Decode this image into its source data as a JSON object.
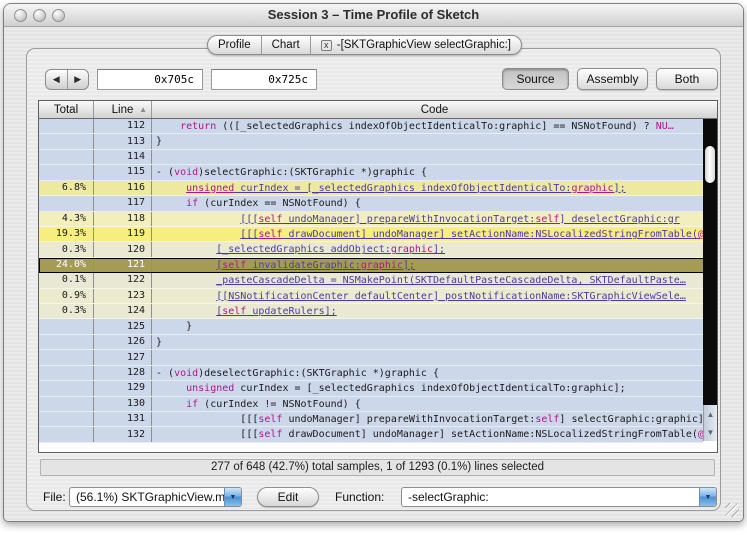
{
  "window": {
    "title": "Session 3 – Time Profile of Sketch",
    "controls": [
      "close",
      "minimize",
      "zoom"
    ]
  },
  "tabs": {
    "items": [
      {
        "label": "Profile",
        "closable": false
      },
      {
        "label": "Chart",
        "closable": false
      },
      {
        "label": "-[SKTGraphicView selectGraphic:]",
        "closable": true,
        "close_glyph": "x"
      }
    ]
  },
  "toolbar": {
    "back_icon": "◀",
    "forward_icon": "▶",
    "addr_start": "0x705c",
    "addr_end": "0x725c",
    "views": [
      {
        "label": "Source",
        "selected": true
      },
      {
        "label": "Assembly",
        "selected": false
      },
      {
        "label": "Both",
        "selected": false
      }
    ]
  },
  "table": {
    "columns": [
      "Total",
      "Line",
      "Code"
    ],
    "sort_column": "Line",
    "sort_ascending": true,
    "rows": [
      {
        "total": "",
        "line": "112",
        "indent": 4,
        "code": [
          [
            "kw",
            "return"
          ],
          [
            "plain",
            " (([_selectedGraphics indexOfObjectIdenticalTo:graphic] == NSNotFound) ? "
          ],
          [
            "kw",
            "NU…"
          ]
        ]
      },
      {
        "total": "",
        "line": "113",
        "indent": 0,
        "code": [
          [
            "plain",
            "}"
          ]
        ]
      },
      {
        "total": "",
        "line": "114",
        "indent": 0,
        "code": []
      },
      {
        "total": "",
        "line": "115",
        "indent": 0,
        "code": [
          [
            "plain",
            "- ("
          ],
          [
            "kw",
            "void"
          ],
          [
            "plain",
            ")selectGraphic:(SKTGraphic *)graphic {"
          ]
        ]
      },
      {
        "total": "6.8%",
        "line": "116",
        "indent": 5,
        "heat": "#eee9a1",
        "code": [
          [
            "kwlink",
            "unsigned"
          ],
          [
            "link",
            " curIndex = [_selectedGraphics indexOfObjectIdenticalTo:"
          ],
          [
            "kwlink",
            "graphic"
          ],
          [
            "link",
            "];"
          ]
        ]
      },
      {
        "total": "",
        "line": "117",
        "indent": 5,
        "code": [
          [
            "kw",
            "if"
          ],
          [
            "plain",
            " (curIndex == NSNotFound) {"
          ]
        ]
      },
      {
        "total": "4.3%",
        "line": "118",
        "indent": 14,
        "heat": "#f3efbd",
        "code": [
          [
            "link",
            "[[["
          ],
          [
            "kwlink",
            "self"
          ],
          [
            "link",
            " undoManager] prepareWithInvocationTarget:"
          ],
          [
            "kwlink",
            "self"
          ],
          [
            "link",
            "] deselectGraphic:gr"
          ]
        ]
      },
      {
        "total": "19.3%",
        "line": "119",
        "indent": 14,
        "heat": "#f6ee7e",
        "code": [
          [
            "link",
            "[[["
          ],
          [
            "kwlink",
            "self"
          ],
          [
            "link",
            " drawDocument] undoManager] setActionName:NSLocalizedStringFromTable("
          ],
          [
            "kwlink",
            "@…"
          ]
        ]
      },
      {
        "total": "0.3%",
        "line": "120",
        "indent": 10,
        "heat": "#eae9d2",
        "code": [
          [
            "link",
            "[_selectedGraphics addObject:"
          ],
          [
            "kwlink",
            "graphic"
          ],
          [
            "link",
            "];"
          ]
        ]
      },
      {
        "total": "24.0%",
        "line": "121",
        "indent": 10,
        "selected": true,
        "heat": "#a49c53",
        "code": [
          [
            "link",
            "["
          ],
          [
            "kwlink",
            "self"
          ],
          [
            "link",
            " invalidateGraphic:"
          ],
          [
            "kwlink",
            "graphic"
          ],
          [
            "link",
            "];"
          ]
        ]
      },
      {
        "total": "0.1%",
        "line": "122",
        "indent": 10,
        "heat": "#e9e8d4",
        "code": [
          [
            "link",
            "_pasteCascadeDelta = NSMakePoint(SKTDefaultPasteCascadeDelta, SKTDefaultPaste…"
          ]
        ]
      },
      {
        "total": "0.9%",
        "line": "123",
        "indent": 10,
        "heat": "#ecebcd",
        "code": [
          [
            "link",
            "[[NSNotificationCenter defaultCenter] postNotificationName:SKTGraphicViewSele…"
          ]
        ]
      },
      {
        "total": "0.3%",
        "line": "124",
        "indent": 10,
        "heat": "#eae9d2",
        "code": [
          [
            "link",
            "["
          ],
          [
            "kwlink",
            "self"
          ],
          [
            "link",
            " updateRulers];"
          ]
        ]
      },
      {
        "total": "",
        "line": "125",
        "indent": 5,
        "code": [
          [
            "plain",
            "}"
          ]
        ]
      },
      {
        "total": "",
        "line": "126",
        "indent": 0,
        "code": [
          [
            "plain",
            "}"
          ]
        ]
      },
      {
        "total": "",
        "line": "127",
        "indent": 0,
        "code": []
      },
      {
        "total": "",
        "line": "128",
        "indent": 0,
        "code": [
          [
            "plain",
            "- ("
          ],
          [
            "kw",
            "void"
          ],
          [
            "plain",
            ")deselectGraphic:(SKTGraphic *)graphic {"
          ]
        ]
      },
      {
        "total": "",
        "line": "129",
        "indent": 5,
        "code": [
          [
            "kw",
            "unsigned"
          ],
          [
            "plain",
            " curIndex = [_selectedGraphics indexOfObjectIdenticalTo:graphic];"
          ]
        ]
      },
      {
        "total": "",
        "line": "130",
        "indent": 5,
        "code": [
          [
            "kw",
            "if"
          ],
          [
            "plain",
            " (curIndex != NSNotFound) {"
          ]
        ]
      },
      {
        "total": "",
        "line": "131",
        "indent": 14,
        "code": [
          [
            "plain",
            "[[["
          ],
          [
            "kw",
            "self"
          ],
          [
            "plain",
            " undoManager] prepareWithInvocationTarget:"
          ],
          [
            "kw",
            "self"
          ],
          [
            "plain",
            "] selectGraphic:graphic];"
          ]
        ]
      },
      {
        "total": "",
        "line": "132",
        "indent": 14,
        "code": [
          [
            "plain",
            "[[["
          ],
          [
            "kw",
            "self"
          ],
          [
            "plain",
            " drawDocument] undoManager] setActionName:NSLocalizedStringFromTable("
          ],
          [
            "kw",
            "@…"
          ]
        ]
      }
    ]
  },
  "scrollbar": {
    "up_icon": "▲",
    "down_icon": "▼"
  },
  "status": "277 of 648 (42.7%) total samples, 1 of 1293 (0.1%) lines selected",
  "footer": {
    "file_label": "File:",
    "file_value": "(56.1%) SKTGraphicView.m",
    "edit_label": "Edit",
    "function_label": "Function:",
    "function_value": "-selectGraphic:",
    "dropdown_icon": "▼"
  },
  "colors": {
    "row_default": "#ccd8ea",
    "row_selected": "#a49c53",
    "syntax_keyword": "#b0148c",
    "syntax_link": "#4a3aa6",
    "combo_accent": "#4d8ed0"
  }
}
